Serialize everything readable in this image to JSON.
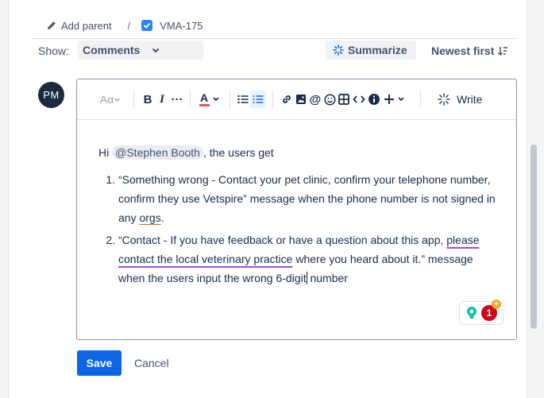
{
  "breadcrumb": {
    "add_parent_label": "Add parent",
    "separator": "/",
    "issue_key": "VMA-175"
  },
  "activity": {
    "show_label": "Show:",
    "filter_value": "Comments",
    "summarize_label": "Summarize",
    "sort_label": "Newest first"
  },
  "comment": {
    "avatar_initials": "PM",
    "toolbar": {
      "text_style": "Aα",
      "write_label": "Write"
    },
    "body": {
      "greeting": "Hi",
      "mention": "@Stephen Booth",
      "intro_rest": ", the users get",
      "item1_text": "“Something wrong - Contact your pet clinic, confirm your telephone number, confirm they use Vetspire” message when the phone number is not signed in any ",
      "item1_underlined": "orgs",
      "item1_end": ".",
      "item2_start": "“Contact - If you have feedback or have a question about this app, ",
      "item2_underlined": "please contact the local veterinary practice",
      "item2_mid": " where you heard about it.” message when the users input the wrong 6-digit",
      "item2_end": " number"
    },
    "assistant_badge_count": "1",
    "assistant_badge_plus": "+",
    "save_label": "Save",
    "cancel_label": "Cancel"
  }
}
